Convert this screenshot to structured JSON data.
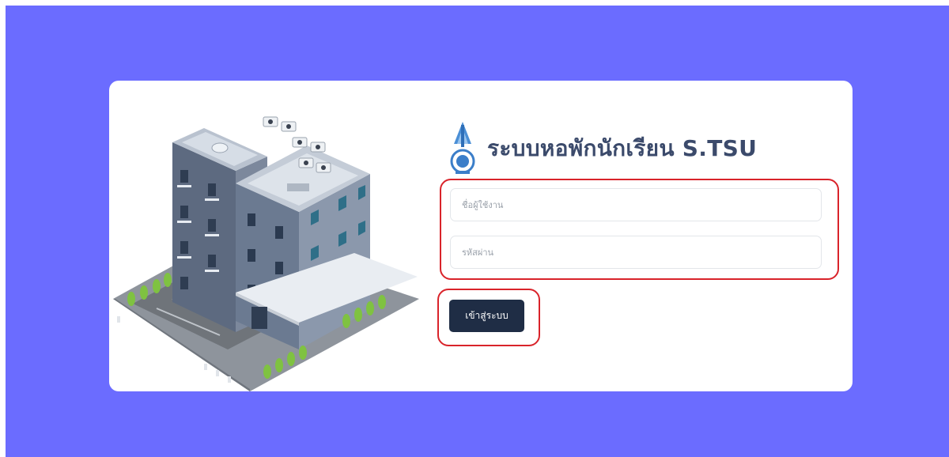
{
  "app": {
    "title": "ระบบหอพักนักเรียน S.TSU"
  },
  "login": {
    "username_placeholder": "ชื่อผู้ใช้งาน",
    "username_value": "",
    "password_placeholder": "รหัสผ่าน",
    "password_value": "",
    "submit_label": "เข้าสู่ระบบ"
  },
  "colors": {
    "page_background": "#6b6cff",
    "card_background": "#ffffff",
    "title_color": "#3b4a6b",
    "button_background": "#1f2d45",
    "highlight_outline": "#d9232a"
  },
  "icons": {
    "brand_logo": "school-emblem-icon",
    "illustration": "dormitory-building-illustration"
  }
}
